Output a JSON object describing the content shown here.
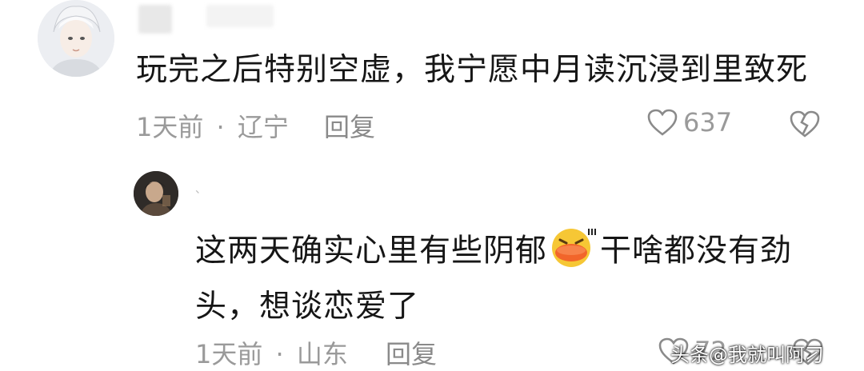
{
  "comments": [
    {
      "text": "玩完之后特别空虚，我宁愿中月读沉浸到里致死",
      "time": "1天前",
      "separator": "·",
      "location": "辽宁",
      "reply_label": "回复",
      "likes": "637"
    },
    {
      "text_before_emoji": "这两天确实心里有些阴郁",
      "emoji": "duck-face-emoji",
      "text_after_emoji_line1": "干啥都没有劲",
      "text_line2": "头，想谈恋爱了",
      "time": "1天前",
      "separator": "·",
      "location": "山东",
      "reply_label": "回复",
      "likes": "72"
    }
  ],
  "watermark": "头条@我就叫阿刁",
  "colors": {
    "meta": "#9a9a9a",
    "text": "#161616",
    "background": "#ffffff"
  }
}
